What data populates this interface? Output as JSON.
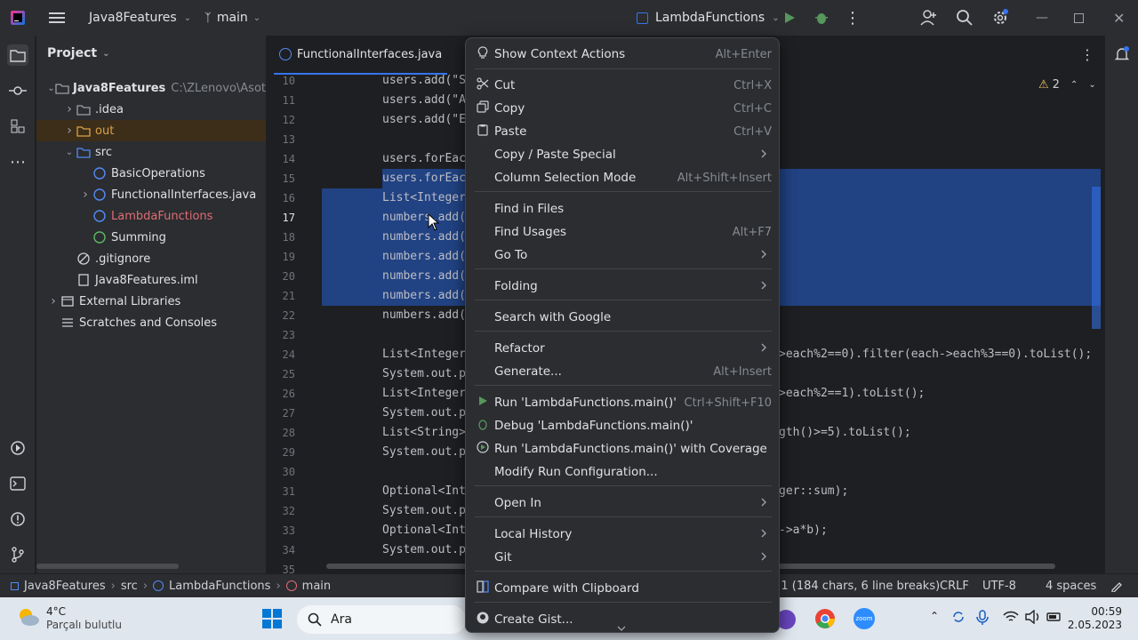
{
  "titlebar": {
    "project": "Java8Features",
    "branch": "main",
    "run_config": "LambdaFunctions"
  },
  "project_panel": {
    "title": "Project",
    "tree": [
      {
        "label": "Java8Features",
        "path": "C:\\ZLenovo\\Asot",
        "icon": "folder-icon",
        "arrow": "down"
      },
      {
        "label": ".idea",
        "icon": "folder-icon",
        "arrow": "right"
      },
      {
        "label": "out",
        "icon": "folder-excluded-icon",
        "arrow": "right"
      },
      {
        "label": "src",
        "icon": "source-folder-icon",
        "arrow": "down"
      },
      {
        "label": "BasicOperations",
        "icon": "class-icon",
        "arrow": "none"
      },
      {
        "label": "FunctionalInterfaces.java",
        "icon": "class-icon",
        "arrow": "right"
      },
      {
        "label": "LambdaFunctions",
        "icon": "class-icon",
        "arrow": "none"
      },
      {
        "label": "Summing",
        "icon": "interface-icon",
        "arrow": "none"
      },
      {
        "label": ".gitignore",
        "icon": "gitignore-icon",
        "arrow": "none"
      },
      {
        "label": "Java8Features.iml",
        "icon": "file-icon",
        "arrow": "none"
      },
      {
        "label": "External Libraries",
        "icon": "library-icon",
        "arrow": "right"
      },
      {
        "label": "Scratches and Consoles",
        "icon": "scratches-icon",
        "arrow": "none"
      }
    ]
  },
  "editor": {
    "tab": "FunctionalInterfaces.java",
    "warnings": "2",
    "line_numbers": [
      "10",
      "11",
      "12",
      "13",
      "14",
      "15",
      "16",
      "17",
      "18",
      "19",
      "20",
      "21",
      "22",
      "23",
      "24",
      "25",
      "26",
      "27",
      "28",
      "29",
      "30",
      "31",
      "32",
      "33",
      "34",
      "35"
    ],
    "code_left": [
      "users.add(\"S",
      "users.add(\"A",
      "users.add(\"E",
      "",
      "users.forEac",
      "users.forEac",
      "List<Integer",
      "numbers.add(",
      "numbers.add(",
      "numbers.add(",
      "numbers.add(",
      "numbers.add(",
      "numbers.add(",
      "",
      "List<Integer",
      "System.out.p",
      "List<Integer",
      "System.out.p",
      "List<String>",
      "System.out.p",
      "",
      "Optional<Int",
      "System.out.p",
      "Optional<Int",
      "System.out.p",
      ""
    ],
    "code_right": [
      {
        "line": "24",
        "text": ">each%2==0).filter(each->each%3==0).toList();"
      },
      {
        "line": "26",
        "text": ">each%2==1).toList();"
      },
      {
        "line": "28",
        "text": "gth()>=5).toList();"
      },
      {
        "line": "31",
        "text": "ger::sum);"
      },
      {
        "line": "33",
        "text": "->a*b);"
      }
    ]
  },
  "context_menu": {
    "items": [
      {
        "icon": "lightbulb-icon",
        "label": "Show Context Actions",
        "shortcut": "Alt+Enter"
      },
      {
        "icon": "cut-icon",
        "label": "Cut",
        "shortcut": "Ctrl+X"
      },
      {
        "icon": "copy-icon",
        "label": "Copy",
        "shortcut": "Ctrl+C"
      },
      {
        "icon": "paste-icon",
        "label": "Paste",
        "shortcut": "Ctrl+V"
      },
      {
        "icon": "",
        "label": "Copy / Paste Special",
        "shortcut": ""
      },
      {
        "icon": "",
        "label": "Column Selection Mode",
        "shortcut": "Alt+Shift+Insert"
      },
      {
        "icon": "",
        "label": "Find in Files",
        "shortcut": ""
      },
      {
        "icon": "",
        "label": "Find Usages",
        "shortcut": "Alt+F7"
      },
      {
        "icon": "",
        "label": "Go To",
        "shortcut": ""
      },
      {
        "icon": "",
        "label": "Folding",
        "shortcut": ""
      },
      {
        "icon": "",
        "label": "Search with Google",
        "shortcut": ""
      },
      {
        "icon": "",
        "label": "Refactor",
        "shortcut": ""
      },
      {
        "icon": "",
        "label": "Generate...",
        "shortcut": "Alt+Insert"
      },
      {
        "icon": "run-icon",
        "label": "Run 'LambdaFunctions.main()'",
        "shortcut": "Ctrl+Shift+F10"
      },
      {
        "icon": "debug-icon",
        "label": "Debug 'LambdaFunctions.main()'",
        "shortcut": ""
      },
      {
        "icon": "coverage-icon",
        "label": "Run 'LambdaFunctions.main()' with Coverage",
        "shortcut": ""
      },
      {
        "icon": "",
        "label": "Modify Run Configuration...",
        "shortcut": ""
      },
      {
        "icon": "",
        "label": "Open In",
        "shortcut": ""
      },
      {
        "icon": "",
        "label": "Local History",
        "shortcut": ""
      },
      {
        "icon": "",
        "label": "Git",
        "shortcut": ""
      },
      {
        "icon": "compare-icon",
        "label": "Compare with Clipboard",
        "shortcut": ""
      },
      {
        "icon": "github-icon",
        "label": "Create Gist...",
        "shortcut": ""
      }
    ]
  },
  "statusbar": {
    "breadcrumb": [
      "Java8Features",
      "src",
      "LambdaFunctions",
      "main"
    ],
    "selection": ":1 (184 chars, 6 line breaks)",
    "line_sep": "CRLF",
    "encoding": "UTF-8",
    "indent": "4 spaces"
  },
  "taskbar": {
    "temp": "4°C",
    "weather": "Parçalı bulutlu",
    "search": "Ara",
    "time": "00:59",
    "date": "2.05.2023"
  },
  "colors": {
    "selection": "#214283",
    "accent": "#3574f0",
    "menu_bg": "#2b2d30"
  }
}
